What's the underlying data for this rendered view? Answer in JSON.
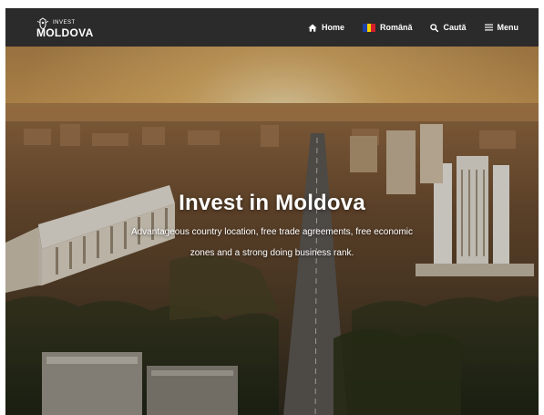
{
  "header": {
    "logo": {
      "line1": "INVEST",
      "line2": "MOLDOVA"
    },
    "nav": [
      {
        "label": "Home",
        "icon": "home-icon"
      },
      {
        "label": "Română",
        "icon": "romania-flag-icon"
      },
      {
        "label": "Caută",
        "icon": "search-icon"
      },
      {
        "label": "Menu",
        "icon": "menu-icon"
      }
    ]
  },
  "hero": {
    "title": "Invest in Moldova",
    "subtitle": "Advantageous country location, free trade agreements, free economic zones and a strong doing business rank."
  },
  "colors": {
    "navbar": "#2b2b2b",
    "flag_blue": "#1e3fa8",
    "flag_yellow": "#f5d000",
    "flag_red": "#d21f2b"
  }
}
